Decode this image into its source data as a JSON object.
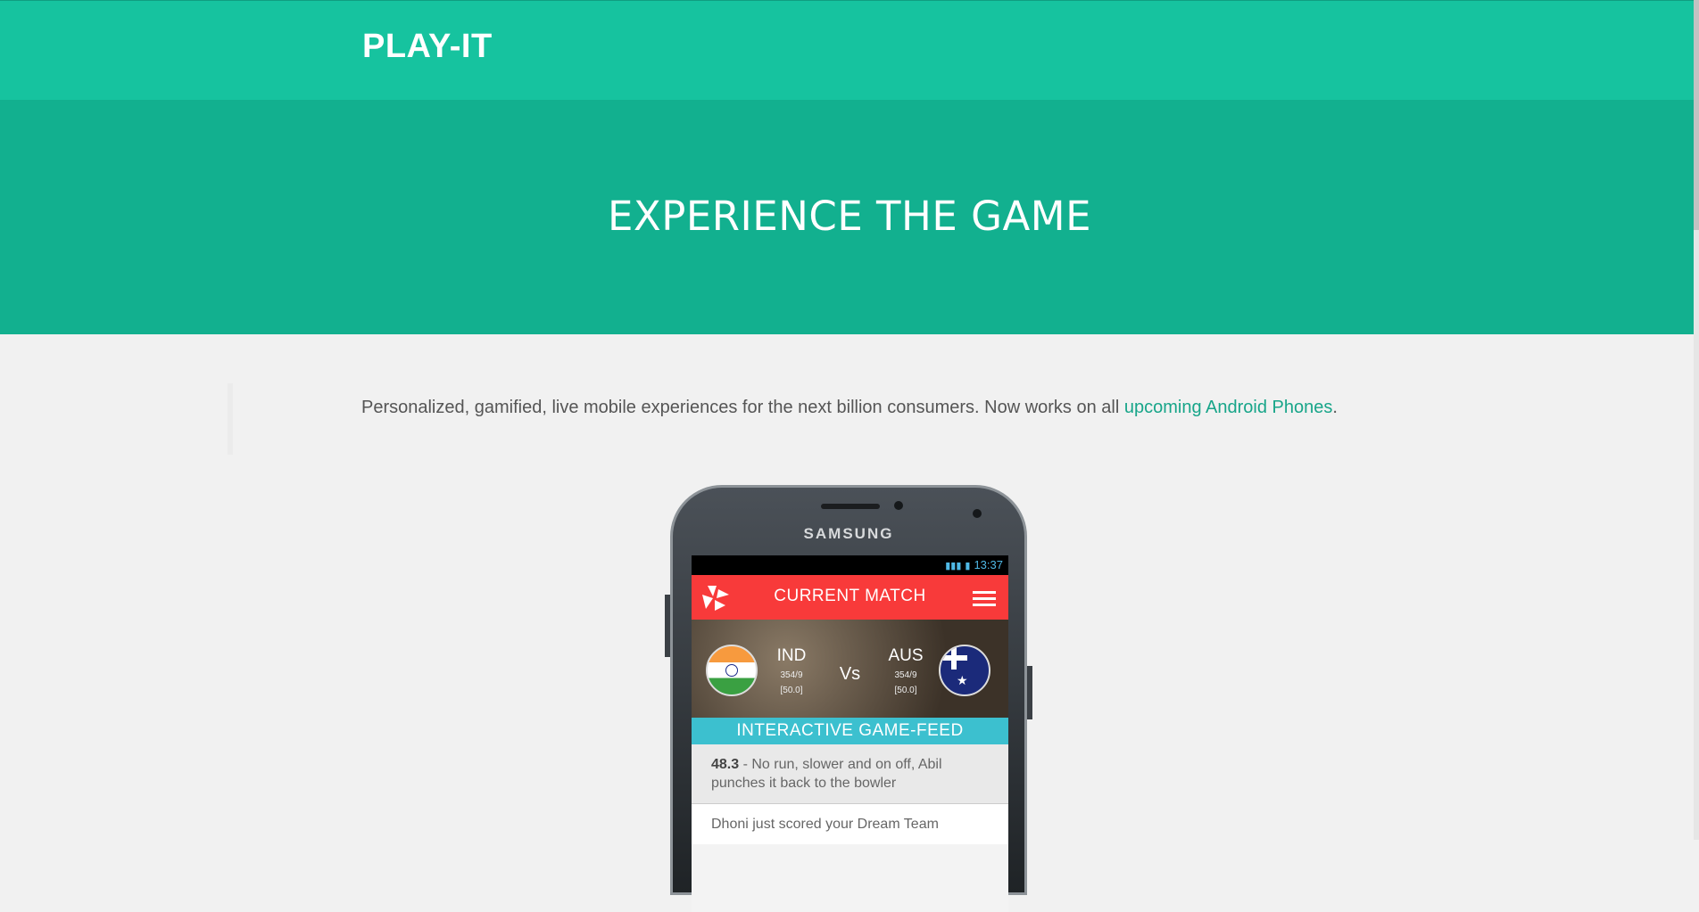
{
  "nav": {
    "brand": "PLAY-IT"
  },
  "hero": {
    "title": "EXPERIENCE THE GAME"
  },
  "intro": {
    "text_before": "Personalized, gamified, live mobile experiences for the next billion consumers. Now works on all ",
    "link_text": "upcoming Android Phones",
    "text_after": "."
  },
  "phone": {
    "maker": "SAMSUNG",
    "status_time": "13:37",
    "app_title": "CURRENT MATCH",
    "team_left": {
      "name": "IND",
      "score": "354/9",
      "overs": "[50.0]"
    },
    "vs": "Vs",
    "team_right": {
      "name": "AUS",
      "score": "354/9",
      "overs": "[50.0]"
    },
    "feed_title": "INTERACTIVE GAME-FEED",
    "feed_item_over": "48.3",
    "feed_item_text": " - No run, slower and on off, Abil punches it back to the bowler",
    "feed_item2_text": "Dhoni just scored your Dream Team"
  },
  "colors": {
    "navbar": "#16c39f",
    "hero": "#12b08f",
    "link": "#17a589",
    "app_bar": "#f83a3a",
    "feed_header": "#3cc0cf"
  }
}
